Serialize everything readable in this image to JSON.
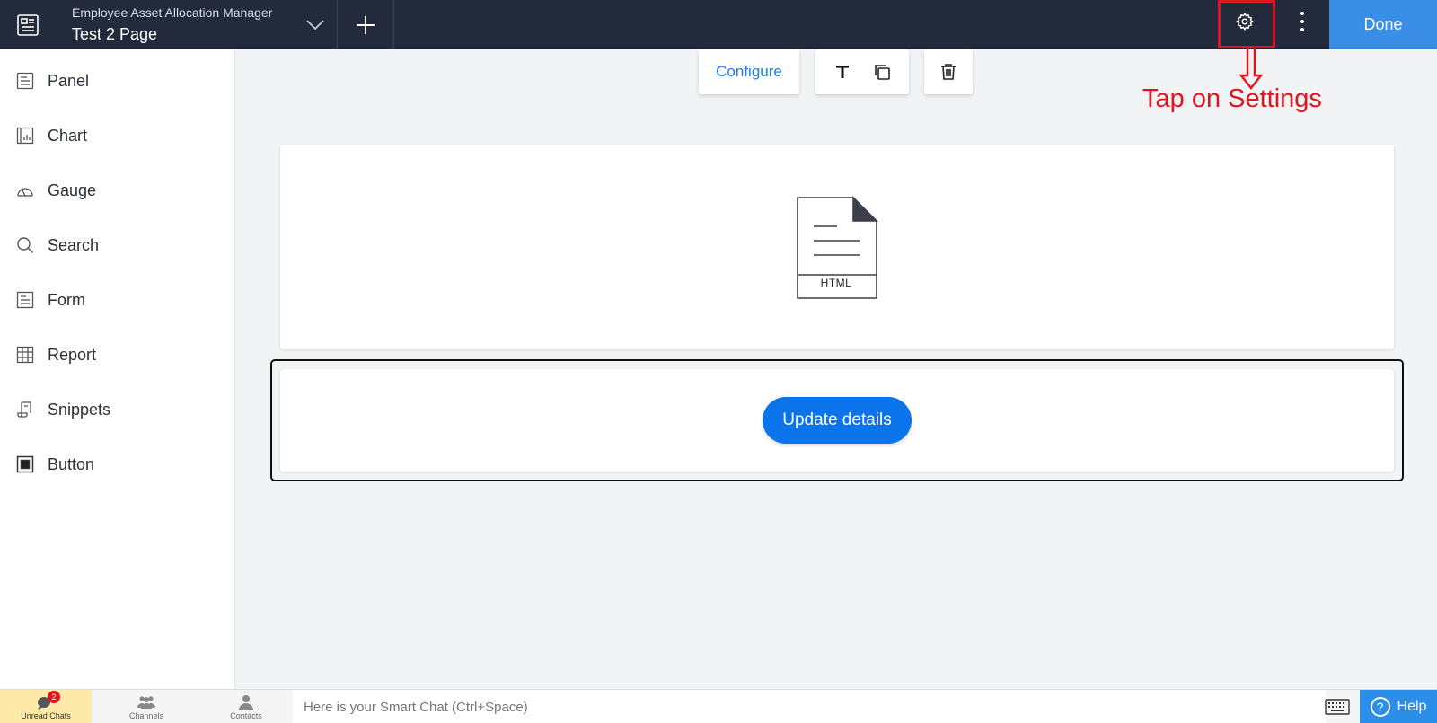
{
  "header": {
    "app_name": "Employee Asset Allocation Manager",
    "page_name": "Test 2 Page",
    "done_label": "Done"
  },
  "annotation": {
    "text": "Tap on Settings",
    "color": "#e0161e"
  },
  "sidebar": {
    "items": [
      {
        "label": "Panel",
        "icon": "panel-icon"
      },
      {
        "label": "Chart",
        "icon": "chart-icon"
      },
      {
        "label": "Gauge",
        "icon": "gauge-icon"
      },
      {
        "label": "Search",
        "icon": "search-icon"
      },
      {
        "label": "Form",
        "icon": "form-icon"
      },
      {
        "label": "Report",
        "icon": "report-icon"
      },
      {
        "label": "Snippets",
        "icon": "snippets-icon"
      },
      {
        "label": "Button",
        "icon": "button-icon"
      }
    ]
  },
  "toolbar": {
    "configure_label": "Configure"
  },
  "canvas": {
    "html_label": "HTML",
    "update_button_label": "Update details"
  },
  "bottombar": {
    "unread_label": "Unread Chats",
    "unread_count": "2",
    "channels_label": "Channels",
    "contacts_label": "Contacts",
    "chat_placeholder": "Here is your Smart Chat (Ctrl+Space)",
    "help_label": "Help"
  },
  "colors": {
    "topbar": "#222a3c",
    "done": "#3a8ee6",
    "primary": "#0b74ea",
    "annotation": "#e0161e"
  }
}
